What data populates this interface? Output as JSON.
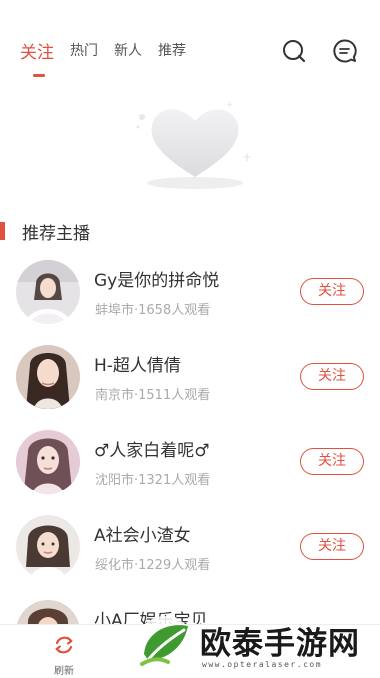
{
  "tabs": [
    {
      "label": "关注"
    },
    {
      "label": "热门"
    },
    {
      "label": "新人"
    },
    {
      "label": "推荐"
    }
  ],
  "accent_color": "#e0513f",
  "section": {
    "title": "推荐主播"
  },
  "streamers": [
    {
      "name": "Gy是你的拼命悦",
      "meta": "蚌埠市·1658人观看",
      "follow_label": "关注"
    },
    {
      "name": "H-超人倩倩",
      "meta": "南京市·1511人观看",
      "follow_label": "关注"
    },
    {
      "name": "♂人家白着呢♂",
      "meta": "沈阳市·1321人观看",
      "follow_label": "关注"
    },
    {
      "name": "A社会小渣女",
      "meta": "绥化市·1229人观看",
      "follow_label": "关注"
    },
    {
      "name": "小A厂娱乐宝贝",
      "meta": "",
      "follow_label": ""
    }
  ],
  "bottom": {
    "refresh_label": "刷新"
  },
  "watermark": {
    "text": "欧泰手游网",
    "url": "www.opteralaser.com"
  }
}
